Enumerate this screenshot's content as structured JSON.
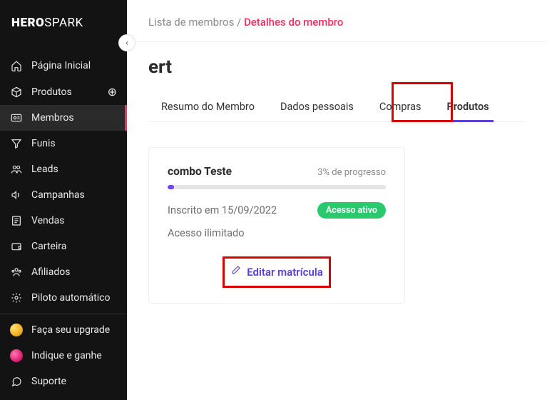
{
  "logo": {
    "hero": "HERO",
    "spark": "SPARK"
  },
  "sidebar": {
    "items": [
      {
        "label": "Página Inicial",
        "icon": "home"
      },
      {
        "label": "Produtos",
        "icon": "box",
        "plus": true
      },
      {
        "label": "Membros",
        "icon": "users",
        "active": true
      },
      {
        "label": "Funis",
        "icon": "funnel"
      },
      {
        "label": "Leads",
        "icon": "people"
      },
      {
        "label": "Campanhas",
        "icon": "megaphone"
      },
      {
        "label": "Vendas",
        "icon": "receipt"
      },
      {
        "label": "Carteira",
        "icon": "wallet"
      },
      {
        "label": "Afiliados",
        "icon": "group"
      },
      {
        "label": "Piloto automático",
        "icon": "gear"
      }
    ],
    "bottom": [
      {
        "label": "Faça seu upgrade"
      },
      {
        "label": "Indique e ganhe"
      },
      {
        "label": "Suporte"
      }
    ]
  },
  "breadcrumb": {
    "parent": "Lista de membros",
    "sep": " / ",
    "current": "Detalhes do membro"
  },
  "page_title": "ert",
  "tabs": [
    {
      "label": "Resumo do Membro"
    },
    {
      "label": "Dados pessoais"
    },
    {
      "label": "Compras"
    },
    {
      "label": "Produtos",
      "active": true
    }
  ],
  "card": {
    "title": "combo Teste",
    "progress_text": "3% de progresso",
    "enrolled": "Inscrito em 15/09/2022",
    "badge": "Acesso ativo",
    "access": "Acesso ilimitado",
    "edit": "Editar matrícula"
  }
}
